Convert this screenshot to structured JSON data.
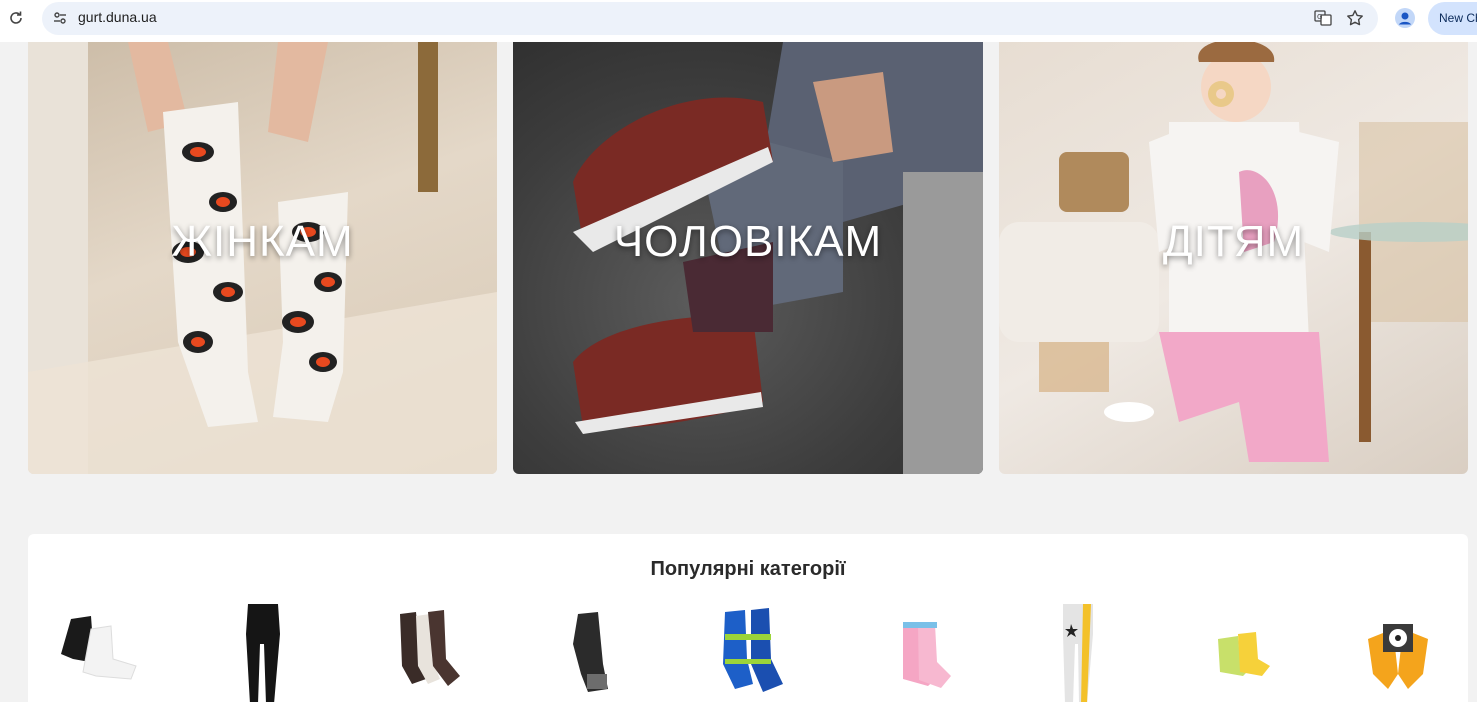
{
  "browser": {
    "url": "gurt.duna.ua",
    "new_chrome_label": "New Ch"
  },
  "tiles": [
    {
      "label": "ЖІНКАМ"
    },
    {
      "label": "ЧОЛОВІКАМ"
    },
    {
      "label": "ДІТЯМ"
    }
  ],
  "popular": {
    "title": "Популярні категорії",
    "items": [
      {
        "icon": "socks-black-white-icon"
      },
      {
        "icon": "tights-black-icon"
      },
      {
        "icon": "socks-brown-icon"
      },
      {
        "icon": "sock-dark-grey-icon"
      },
      {
        "icon": "sport-socks-blue-icon"
      },
      {
        "icon": "kids-socks-pink-icon"
      },
      {
        "icon": "kids-tights-icon"
      },
      {
        "icon": "baby-socks-yellow-icon"
      },
      {
        "icon": "kids-socks-penguin-icon"
      }
    ]
  },
  "colors": {
    "omnibox": "#edf2fa",
    "accent": "#d3e3fd",
    "panel": "#ffffff",
    "page": "#f2f2f2"
  }
}
